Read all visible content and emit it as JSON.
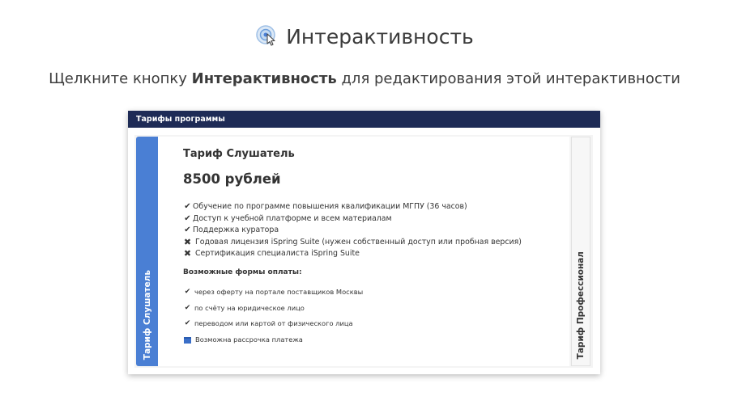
{
  "header": {
    "icon": "pointer-click-icon",
    "title": "Интерактивность",
    "instruction_prefix": "Щелкните кнопку ",
    "instruction_bold": "Интерактивность",
    "instruction_suffix": " для редактирования этой интерактивности"
  },
  "widget": {
    "header_title": "Тарифы программы",
    "tabs": [
      {
        "label": "Тариф Слушатель",
        "active": true
      },
      {
        "label": "Тариф Профессионал",
        "active": false
      }
    ],
    "panel": {
      "tariff_name": "Тариф Слушатель",
      "price": "8500 рублей",
      "features": [
        {
          "icon": "check-icon",
          "text": "Обучение по программе повышения квалификации МГПУ (36 часов)"
        },
        {
          "icon": "check-icon",
          "text": "Доступ к учебной платформе и всем материалам"
        },
        {
          "icon": "check-icon",
          "text": "Поддержка куратора"
        },
        {
          "icon": "cross-icon",
          "text": "Годовая лицензия iSpring Suite (нужен собственный доступ или пробная версия)"
        },
        {
          "icon": "cross-icon",
          "text": "Сертификация специалиста iSpring Suite"
        }
      ],
      "payment_title": "Возможные формы оплаты:",
      "payments": [
        {
          "icon": "check-icon",
          "text": "через оферту на портале поставщиков Москвы"
        },
        {
          "icon": "check-icon",
          "text": "по счёту на юридическое лицо"
        },
        {
          "icon": "check-icon",
          "text": "переводом или картой от физического лица"
        },
        {
          "icon": "credit-card-icon",
          "text": "Возможна рассрочка платежа"
        }
      ]
    }
  },
  "colors": {
    "header_bg": "#1e2b56",
    "active_tab": "#4a7fd4",
    "card_icon": "#3a6fc8"
  }
}
